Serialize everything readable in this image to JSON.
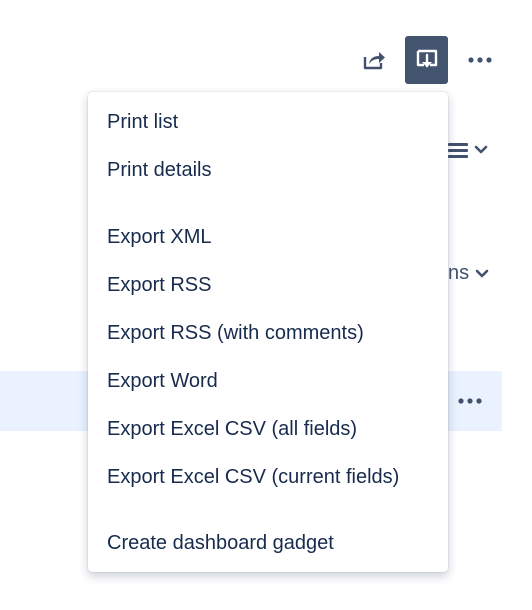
{
  "toolbar": {
    "share_icon": "share-icon",
    "export_icon": "export-icon",
    "more_icon": "more-icon"
  },
  "background": {
    "columns_text": "ns",
    "row_more_icon": "more-icon"
  },
  "menu": {
    "items": [
      {
        "label": "Print list"
      },
      {
        "label": "Print details"
      },
      {
        "label": "Export XML"
      },
      {
        "label": "Export RSS"
      },
      {
        "label": "Export RSS (with comments)"
      },
      {
        "label": "Export Word"
      },
      {
        "label": "Export Excel CSV (all fields)"
      },
      {
        "label": "Export Excel CSV (current fields)"
      },
      {
        "label": "Create dashboard gadget"
      }
    ]
  },
  "colors": {
    "accent": "#43546f",
    "row_highlight": "#e9f2fe",
    "text": "#172b4d",
    "icon": "#42526e"
  }
}
